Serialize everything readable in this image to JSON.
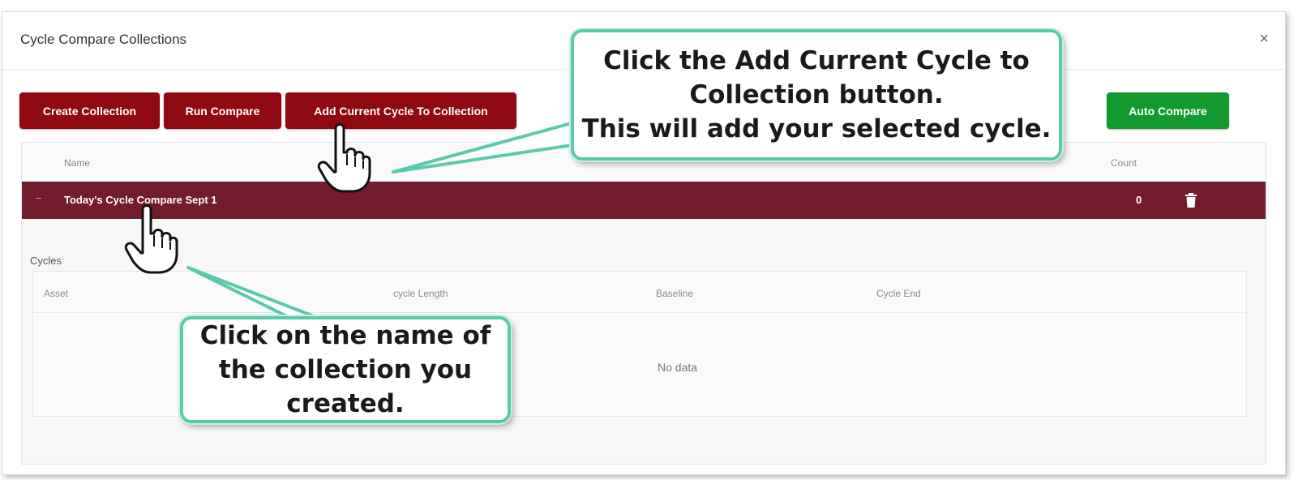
{
  "dialog": {
    "title": "Cycle Compare Collections",
    "close_symbol": "×"
  },
  "toolbar": {
    "create_collection": "Create Collection",
    "run_compare": "Run Compare",
    "add_current_cycle": "Add Current Cycle To Collection",
    "auto_compare": "Auto Compare"
  },
  "collections_table": {
    "columns": {
      "name": "Name",
      "count": "Count"
    },
    "rows": [
      {
        "name": "Today's Cycle Compare Sept 1",
        "count": "0",
        "expander": "−"
      }
    ]
  },
  "cycles": {
    "label": "Cycles",
    "columns": {
      "asset": "Asset",
      "cycle_length": "cycle Length",
      "baseline": "Baseline",
      "cycle_end": "Cycle End"
    },
    "empty_text": "No data"
  },
  "callouts": {
    "top": "Click the Add Current Cycle to Collection button.\nThis will add your selected cycle.",
    "bottom": "Click on the name of the collection you created."
  },
  "colors": {
    "button_red": "#8f0a10",
    "button_green": "#139a2f",
    "selected_row": "#731c2e",
    "callout_border": "#5cc9ad"
  },
  "icons": [
    "close-icon",
    "trash-icon",
    "pointing-hand-icon"
  ]
}
